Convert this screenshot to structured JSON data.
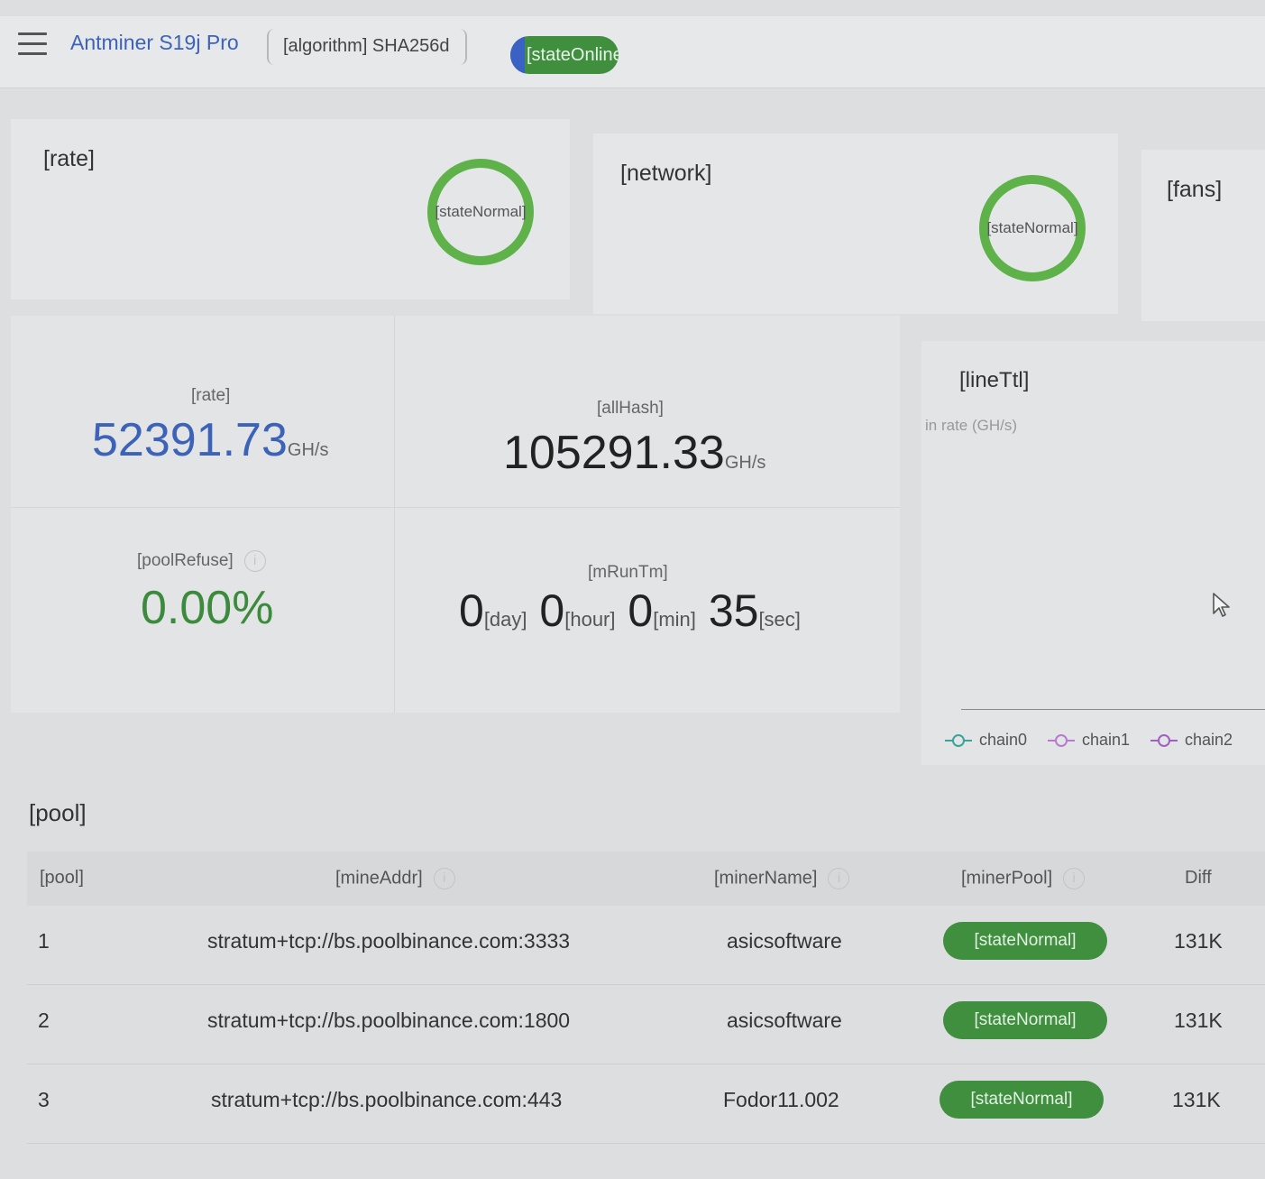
{
  "header": {
    "model": "Antminer S19j Pro",
    "algorithm": "[algorithm] SHA256d",
    "status": "[stateOnline]"
  },
  "status_cards": {
    "rate": {
      "title": "[rate]",
      "state": "[stateNormal]"
    },
    "network": {
      "title": "[network]",
      "state": "[stateNormal]"
    },
    "fans": {
      "title": "[fans]"
    }
  },
  "stats": {
    "rate_label": "[rate]",
    "rate_value": "52391.73",
    "rate_unit": "GH/s",
    "allhash_label": "[allHash]",
    "allhash_value": "105291.33",
    "allhash_unit": "GH/s",
    "pool_refuse_label": "[poolRefuse]",
    "pool_refuse_value": "0.00%",
    "runtime_label": "[mRunTm]",
    "runtime": {
      "day": "0",
      "day_unit": "[day]",
      "hour": "0",
      "hour_unit": "[hour]",
      "min": "0",
      "min_unit": "[min]",
      "sec": "35",
      "sec_unit": "[sec]"
    }
  },
  "line_chart": {
    "title": "[lineTtl]",
    "ylabel": "in rate (GH/s)",
    "legend": [
      {
        "name": "chain0",
        "color": "#3aa39a"
      },
      {
        "name": "chain1",
        "color": "#b77ad0"
      },
      {
        "name": "chain2",
        "color": "#a060c0"
      }
    ]
  },
  "pool": {
    "title": "[pool]",
    "columns": {
      "pool": "[pool]",
      "mine_addr": "[mineAddr]",
      "miner_name": "[minerName]",
      "miner_pool": "[minerPool]",
      "diff": "Diff"
    },
    "rows": [
      {
        "pool": "1",
        "addr": "stratum+tcp://bs.poolbinance.com:3333",
        "name": "asicsoftware",
        "status": "[stateNormal]",
        "diff": "131K"
      },
      {
        "pool": "2",
        "addr": "stratum+tcp://bs.poolbinance.com:1800",
        "name": "asicsoftware",
        "status": "[stateNormal]",
        "diff": "131K"
      },
      {
        "pool": "3",
        "addr": "stratum+tcp://bs.poolbinance.com:443",
        "name": "Fodor11.002",
        "status": "[stateNormal]",
        "diff": "131K"
      }
    ]
  },
  "colors": {
    "accent_blue": "#3d63b8",
    "ok_green": "#3f8f3f",
    "ring_green": "#5fb24a",
    "refuse_green": "#3c8a3c"
  }
}
